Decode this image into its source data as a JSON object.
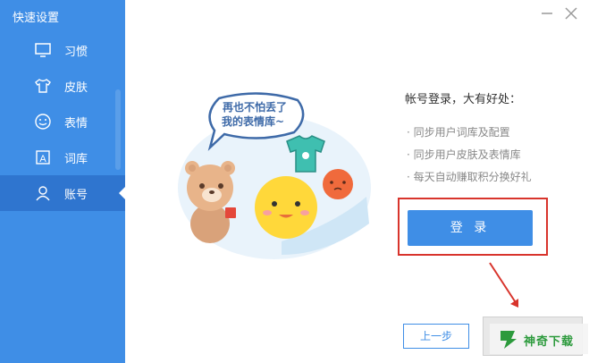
{
  "app": {
    "title": "快速设置"
  },
  "sidebar": {
    "items": [
      {
        "label": "习惯",
        "icon": "monitor-icon"
      },
      {
        "label": "皮肤",
        "icon": "tshirt-icon"
      },
      {
        "label": "表情",
        "icon": "smiley-icon"
      },
      {
        "label": "词库",
        "icon": "letter-a-icon"
      },
      {
        "label": "账号",
        "icon": "user-icon",
        "active": true
      }
    ]
  },
  "illustration": {
    "speech_line1": "再也不怕丢了",
    "speech_line2": "我的表情库~"
  },
  "promo": {
    "title": "帐号登录，大有好处：",
    "benefits": [
      "· 同步用户词库及配置",
      "· 同步用户皮肤及表情库",
      "· 每天自动赚取积分换好礼"
    ]
  },
  "buttons": {
    "login": "登 录",
    "prev": "上一步"
  },
  "watermark": {
    "text": "神奇下载"
  },
  "colors": {
    "accent": "#3f8ee6",
    "accent_active": "#2f75cf",
    "annotation": "#d8342c"
  }
}
